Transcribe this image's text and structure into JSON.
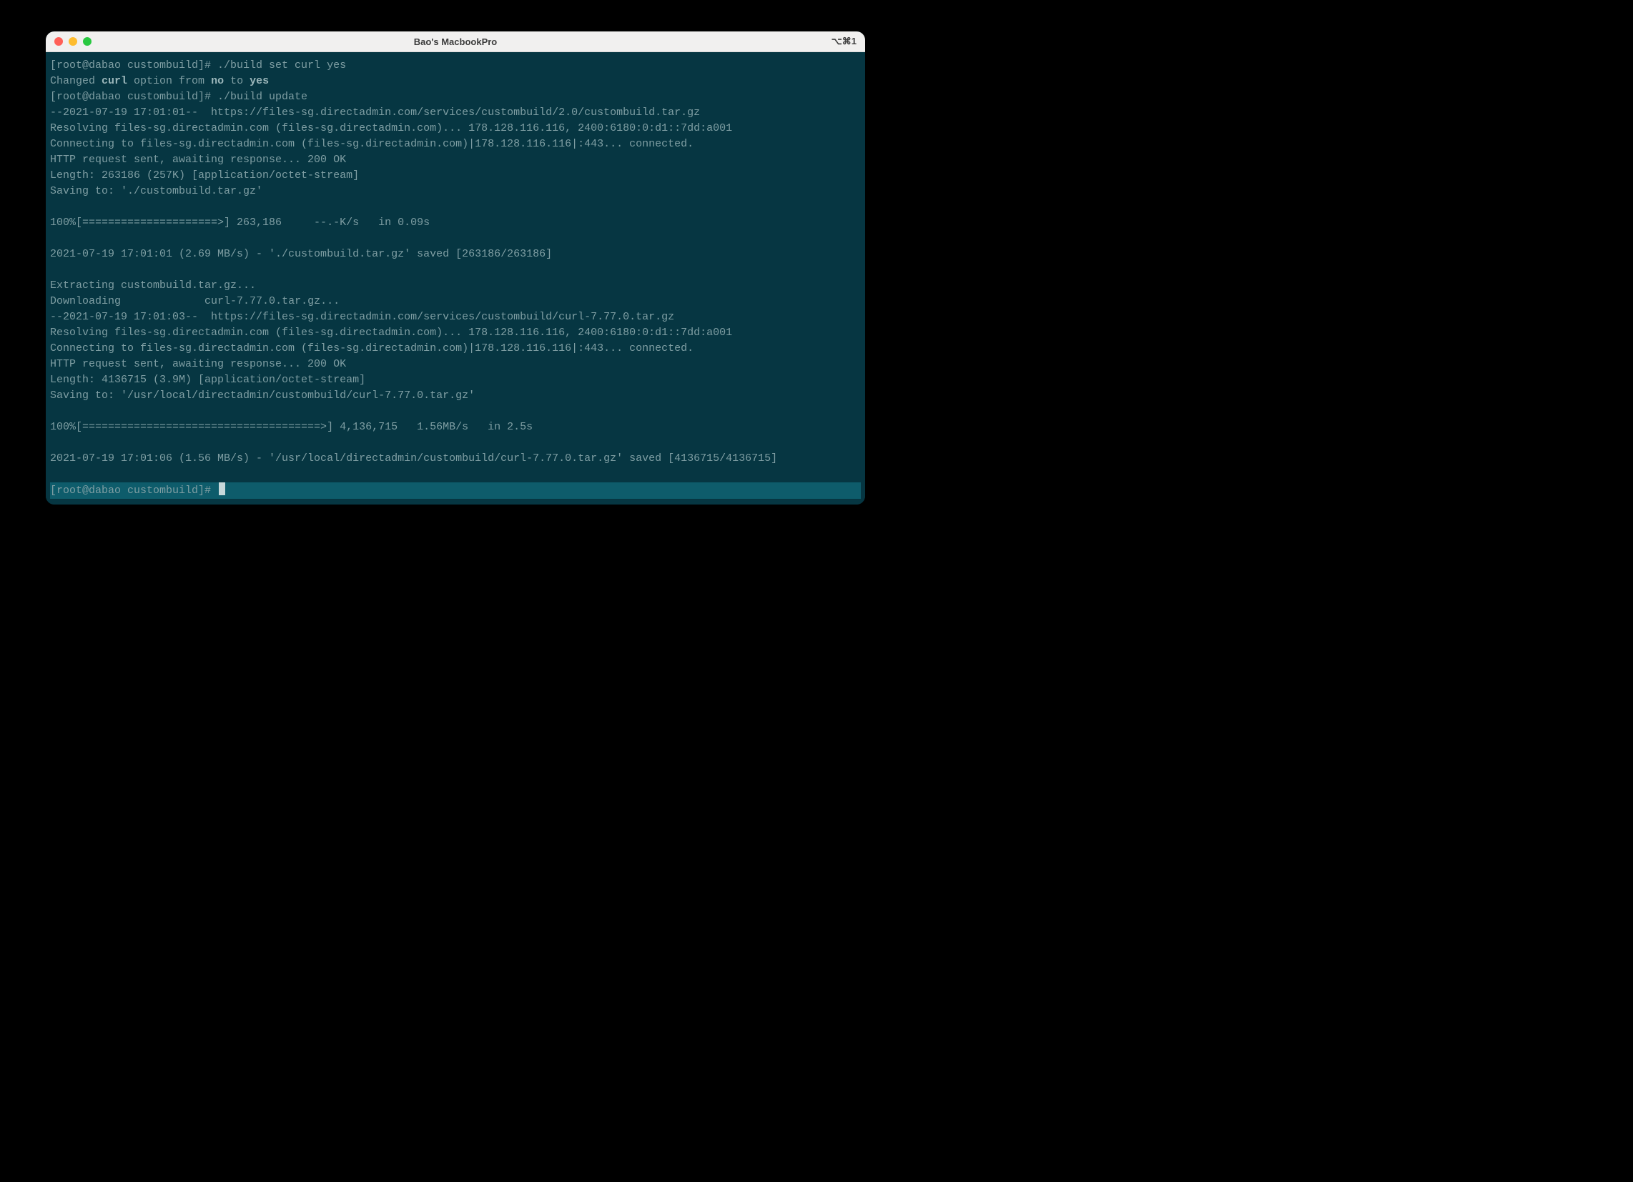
{
  "window": {
    "title": "Bao's MacbookPro",
    "shortcut": "⌥⌘1"
  },
  "colors": {
    "titlebar": "#f1f0ef",
    "term_bg": "#063642",
    "term_fg": "#7f9ea3",
    "traffic": {
      "red": "#ff5f57",
      "yellow": "#febc2e",
      "green": "#28c840"
    }
  },
  "prompt": "[root@dabao custombuild]# ",
  "lines": [
    {
      "t": "prompt_cmd",
      "cmd": "./build set curl yes"
    },
    {
      "t": "changed",
      "pre": "Changed ",
      "opt": "curl",
      "mid": " option from ",
      "from": "no",
      "mid2": " to ",
      "to": "yes"
    },
    {
      "t": "prompt_cmd",
      "cmd": "./build update"
    },
    {
      "t": "plain",
      "text": "--2021-07-19 17:01:01--  https://files-sg.directadmin.com/services/custombuild/2.0/custombuild.tar.gz"
    },
    {
      "t": "plain",
      "text": "Resolving files-sg.directadmin.com (files-sg.directadmin.com)... 178.128.116.116, 2400:6180:0:d1::7dd:a001"
    },
    {
      "t": "plain",
      "text": "Connecting to files-sg.directadmin.com (files-sg.directadmin.com)|178.128.116.116|:443... connected."
    },
    {
      "t": "plain",
      "text": "HTTP request sent, awaiting response... 200 OK"
    },
    {
      "t": "plain",
      "text": "Length: 263186 (257K) [application/octet-stream]"
    },
    {
      "t": "plain",
      "text": "Saving to: './custombuild.tar.gz'"
    },
    {
      "t": "blank"
    },
    {
      "t": "plain",
      "text": "100%[=====================>] 263,186     --.-K/s   in 0.09s"
    },
    {
      "t": "blank"
    },
    {
      "t": "plain",
      "text": "2021-07-19 17:01:01 (2.69 MB/s) - './custombuild.tar.gz' saved [263186/263186]"
    },
    {
      "t": "blank"
    },
    {
      "t": "plain",
      "text": "Extracting custombuild.tar.gz..."
    },
    {
      "t": "plain",
      "text": "Downloading\t\tcurl-7.77.0.tar.gz..."
    },
    {
      "t": "plain",
      "text": "--2021-07-19 17:01:03--  https://files-sg.directadmin.com/services/custombuild/curl-7.77.0.tar.gz"
    },
    {
      "t": "plain",
      "text": "Resolving files-sg.directadmin.com (files-sg.directadmin.com)... 178.128.116.116, 2400:6180:0:d1::7dd:a001"
    },
    {
      "t": "plain",
      "text": "Connecting to files-sg.directadmin.com (files-sg.directadmin.com)|178.128.116.116|:443... connected."
    },
    {
      "t": "plain",
      "text": "HTTP request sent, awaiting response... 200 OK"
    },
    {
      "t": "plain",
      "text": "Length: 4136715 (3.9M) [application/octet-stream]"
    },
    {
      "t": "plain",
      "text": "Saving to: '/usr/local/directadmin/custombuild/curl-7.77.0.tar.gz'"
    },
    {
      "t": "blank"
    },
    {
      "t": "plain",
      "text": "100%[=====================================>] 4,136,715   1.56MB/s   in 2.5s"
    },
    {
      "t": "blank"
    },
    {
      "t": "plain",
      "text": "2021-07-19 17:01:06 (1.56 MB/s) - '/usr/local/directadmin/custombuild/curl-7.77.0.tar.gz' saved [4136715/4136715]"
    },
    {
      "t": "blank"
    },
    {
      "t": "active_prompt"
    }
  ]
}
